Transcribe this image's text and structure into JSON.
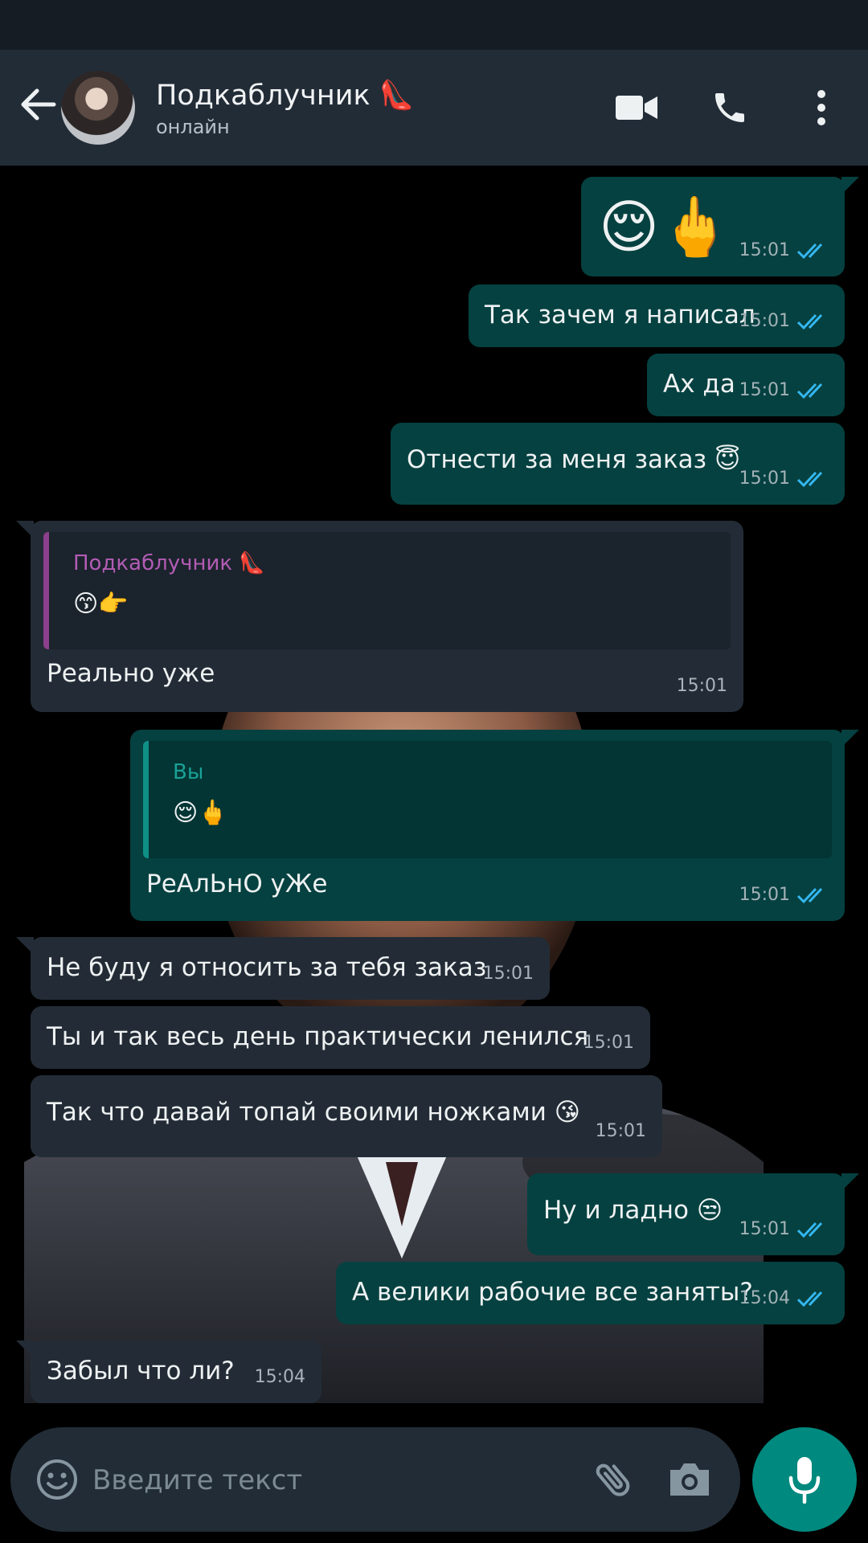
{
  "header": {
    "contact_name": "Подкаблучник 👠",
    "status": "онлайн"
  },
  "messages": [
    {
      "direction": "out",
      "text": "😌🖕",
      "time": "15:01"
    },
    {
      "direction": "out",
      "text": "Так зачем я написал",
      "time": "15:01"
    },
    {
      "direction": "out",
      "text": "Ах да",
      "time": "15:01"
    },
    {
      "direction": "out",
      "text": "Отнести за меня заказ 😇",
      "time": "15:01"
    },
    {
      "direction": "in",
      "quote_author": "Подкаблучник 👠",
      "quote_text": "😙👉",
      "text": "Реально уже",
      "time": "15:01"
    },
    {
      "direction": "out",
      "quote_author": "Вы",
      "quote_text": "😌🖕",
      "text": "РеАлЬнО уЖе",
      "time": "15:01"
    },
    {
      "direction": "in",
      "text": "Не буду я относить за тебя заказ",
      "time": "15:01"
    },
    {
      "direction": "in",
      "text": "Ты и так весь день практически ленился",
      "time": "15:01"
    },
    {
      "direction": "in",
      "text": "Так что давай топай своими ножками 😘",
      "time": "15:01"
    },
    {
      "direction": "out",
      "text": "Ну и ладно 😒",
      "time": "15:01"
    },
    {
      "direction": "out",
      "text": "А велики рабочие все заняты?",
      "time": "15:04"
    },
    {
      "direction": "in",
      "text": "Забыл что ли?",
      "time": "15:04"
    }
  ],
  "composer": {
    "placeholder": "Введите текст"
  },
  "colors": {
    "outgoing_bubble": "#054140",
    "incoming_bubble": "#232c36",
    "accent": "#00897e",
    "read_ticks": "#34b7f1"
  }
}
